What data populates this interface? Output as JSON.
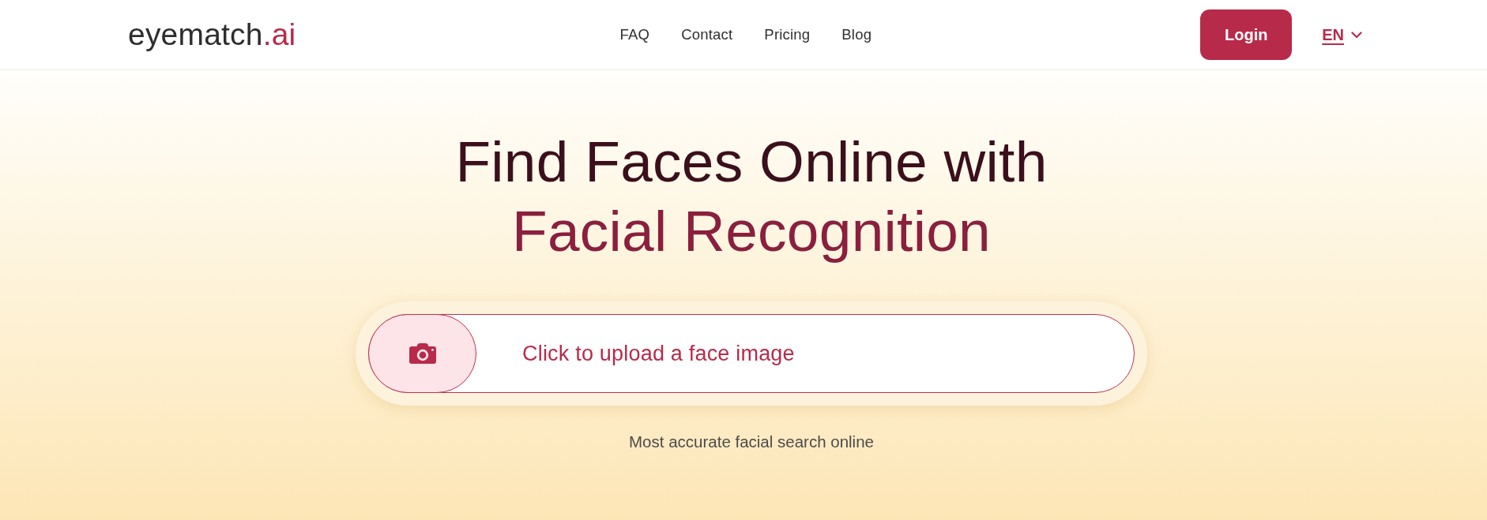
{
  "header": {
    "logo": {
      "name": "eyematch",
      "suffix": ".ai"
    },
    "nav": [
      "FAQ",
      "Contact",
      "Pricing",
      "Blog"
    ],
    "login_button": {
      "label": "Login"
    },
    "language": {
      "label": "EN"
    }
  },
  "hero": {
    "title_line_1": "Find Faces Online with",
    "title_line_2": "Facial Recognition",
    "upload": {
      "label": "Click to upload a face image"
    },
    "tagline": "Most accurate facial search online"
  }
}
